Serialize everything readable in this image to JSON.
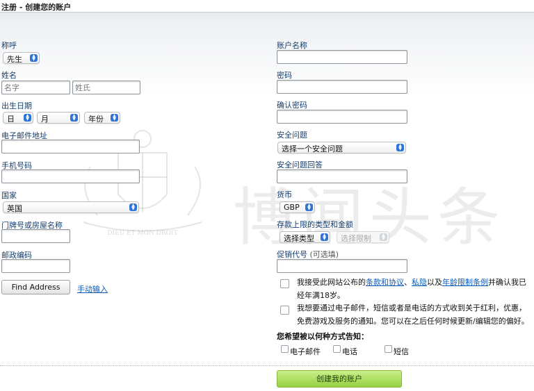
{
  "window": {
    "title": "注册 - 创建您的账户"
  },
  "left": {
    "salutation": {
      "label": "称呼",
      "value": "先生"
    },
    "name": {
      "label": "姓名",
      "first_placeholder": "名字",
      "last_placeholder": "姓氏"
    },
    "dob": {
      "label": "出生日期",
      "day": "日",
      "month": "月",
      "year": "年份"
    },
    "email": {
      "label": "电子邮件地址"
    },
    "mobile": {
      "label": "手机号码"
    },
    "country": {
      "label": "国家",
      "value": "英国"
    },
    "house": {
      "label": "门牌号或房屋名称"
    },
    "postcode": {
      "label": "邮政编码"
    },
    "find_address_label": "Find Address",
    "manual_entry_label": "手动输入"
  },
  "right": {
    "account_name": {
      "label": "账户名称"
    },
    "password": {
      "label": "密码"
    },
    "confirm_password": {
      "label": "确认密码"
    },
    "security_question": {
      "label": "安全问题",
      "value": "选择一个安全问题"
    },
    "security_answer": {
      "label": "安全问题回答"
    },
    "currency": {
      "label": "货币",
      "value": "GBP"
    },
    "deposit_limit": {
      "label": "存款上限的类型和金额",
      "type_value": "选择类型",
      "limit_value": "选择限制"
    },
    "promo": {
      "label": "促销代号",
      "hint": "(可选填)"
    },
    "terms": {
      "prefix": "我接受此网站公布的",
      "terms_link": "条款和协议",
      "sep": "、",
      "privacy_link": "私隐",
      "mid": "以及",
      "age_link": "年龄限制条例",
      "suffix_line1": "并确认我已",
      "line2": "经年满18岁。"
    },
    "marketing": {
      "line1": "我想要通过电子邮件，短信或者是电话的方式收到关于红利，优惠，",
      "line2": "免费游戏及服务的通知。您可以在之后任何时候更新/编辑您的偏好。"
    },
    "notify": {
      "title": "您希望被以何种方式告知：",
      "options": [
        "电子邮件",
        "电话",
        "短信"
      ]
    }
  },
  "create_account_label": "创建我的账户",
  "watermark": {
    "text": "博闻头条",
    "crest_motto": "DIEU ET MON DROIT"
  },
  "colors": {
    "accent": "#2d74d6",
    "link": "#0a5bb5",
    "create_button": "#96d13f"
  }
}
